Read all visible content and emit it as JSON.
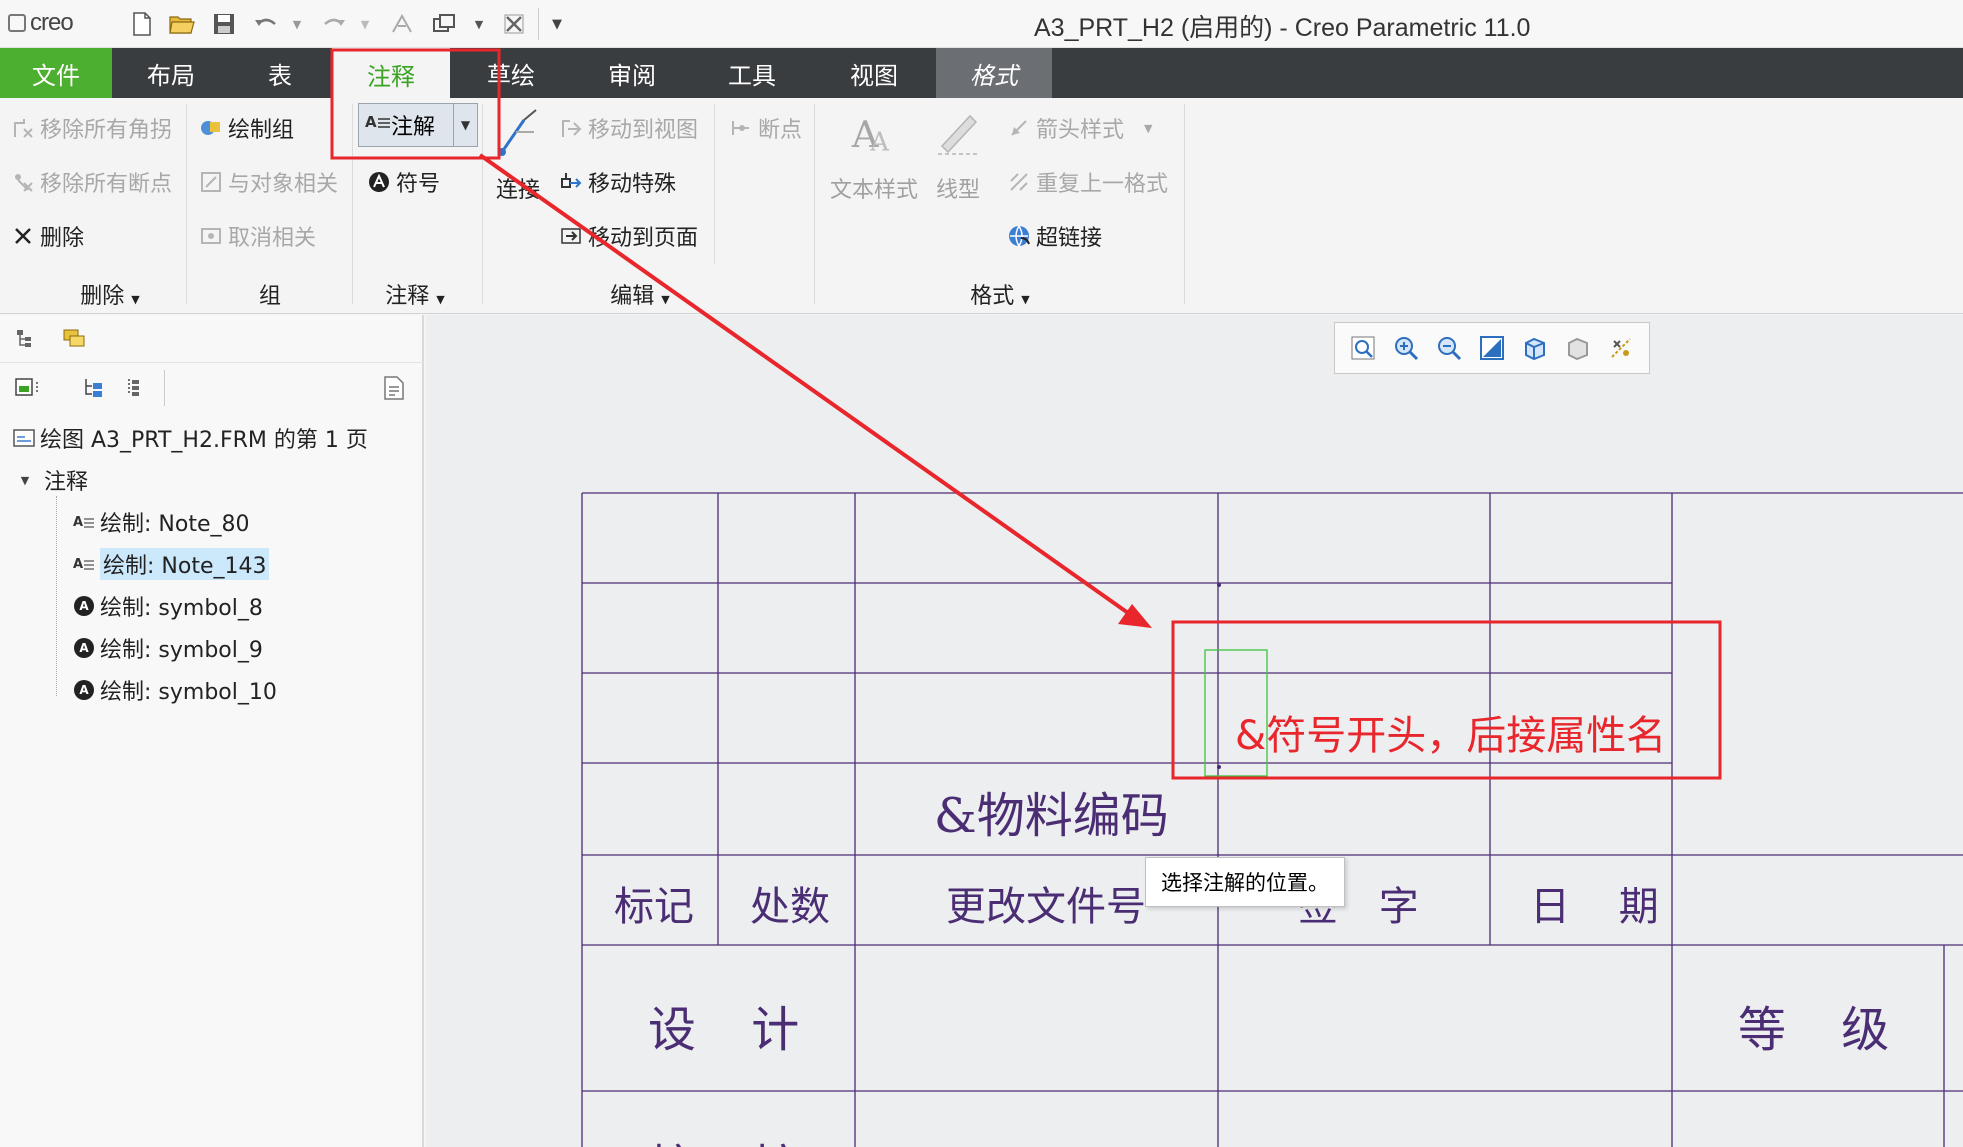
{
  "window": {
    "app_logo": "creo",
    "title": "A3_PRT_H2 (启用的) - Creo Parametric 11.0"
  },
  "quick_access": {
    "icons": [
      "new-file-icon",
      "open-folder-icon",
      "save-icon",
      "undo-icon",
      "redo-icon",
      "regenerate-icon",
      "windows-icon",
      "close-window-icon",
      "customize-icon"
    ]
  },
  "tabs": [
    {
      "label": "文件"
    },
    {
      "label": "布局"
    },
    {
      "label": "表"
    },
    {
      "label": "注释"
    },
    {
      "label": "草绘"
    },
    {
      "label": "审阅"
    },
    {
      "label": "工具"
    },
    {
      "label": "视图"
    },
    {
      "label": "格式"
    }
  ],
  "ribbon": {
    "delete_group": {
      "remove_all_jogs": "移除所有角拐",
      "remove_all_breaks": "移除所有断点",
      "delete": "删除",
      "label": "删除"
    },
    "group_group": {
      "draw_group": "绘制组",
      "relate_to_object": "与对象相关",
      "unrelate": "取消相关",
      "label": "组"
    },
    "annotation_group": {
      "note": "注解",
      "symbol": "符号",
      "label": "注释"
    },
    "edit_group": {
      "connect": "连接",
      "move_to_view": "移动到视图",
      "move_special": "移动特殊",
      "move_to_sheet": "移动到页面",
      "breakpoint": "断点",
      "label": "编辑"
    },
    "format_group": {
      "text_style": "文本样式",
      "line_style": "线型",
      "arrow_style": "箭头样式",
      "repeat_last_format": "重复上一格式",
      "hyperlink": "超链接",
      "label": "格式"
    }
  },
  "tree": {
    "root": "绘图 A3_PRT_H2.FRM 的第 1 页",
    "annotations_node": "注释",
    "items": [
      {
        "label": "绘制: Note_80",
        "icon": "note-icon"
      },
      {
        "label": "绘制: Note_143",
        "icon": "note-icon",
        "selected": true
      },
      {
        "label": "绘制: symbol_8",
        "icon": "symbol-icon"
      },
      {
        "label": "绘制: symbol_9",
        "icon": "symbol-icon"
      },
      {
        "label": "绘制: symbol_10",
        "icon": "symbol-icon"
      }
    ]
  },
  "drawing": {
    "material_code": "&物料编码",
    "headers": {
      "mark": "标记",
      "count": "处数",
      "change_doc": "更改文件号",
      "signature": "签 字",
      "date": "日 期",
      "design": "设 计",
      "grade": "等 级"
    },
    "row3": {
      "check": "校 核"
    },
    "tooltip": "选择注解的位置。",
    "callout": "&符号开头，后接属性名"
  },
  "colors": {
    "tab_bar": "#3a3d40",
    "file_tab": "#4caf2f",
    "active_tab_text": "#3aa324",
    "drawing_line": "#4b2d74",
    "annotation_red": "#e8262b",
    "selection_blue": "#cce8fb"
  }
}
